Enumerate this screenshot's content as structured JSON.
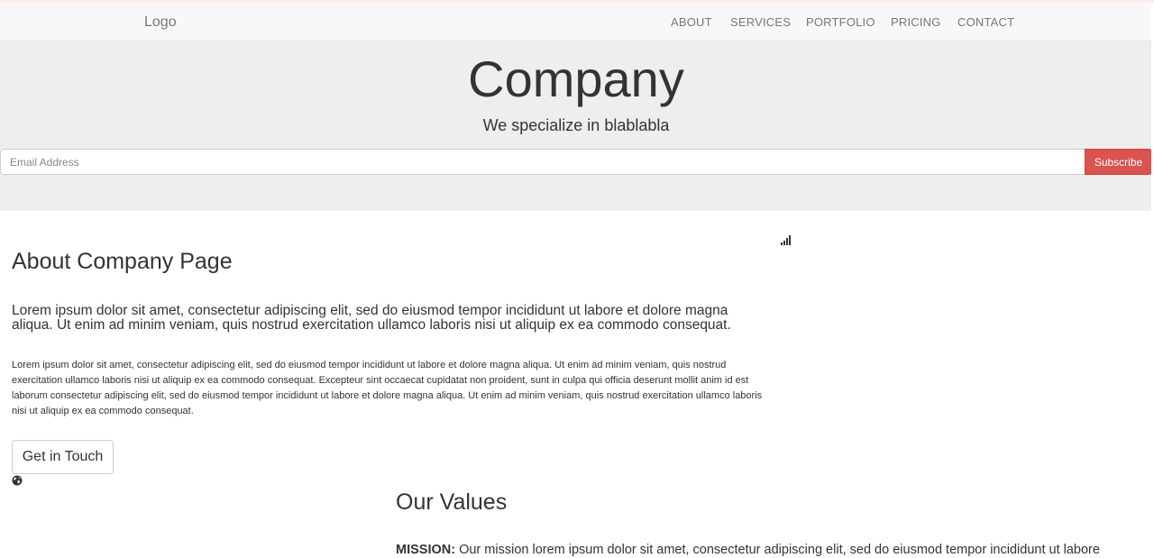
{
  "navbar": {
    "logo": "Logo",
    "items": [
      {
        "label": "ABOUT"
      },
      {
        "label": "SERVICES"
      },
      {
        "label": "PORTFOLIO"
      },
      {
        "label": "PRICING"
      },
      {
        "label": "CONTACT"
      }
    ]
  },
  "hero": {
    "title": "Company",
    "tagline": "We specialize in blablabla",
    "email_placeholder": "Email Address",
    "email_value": "",
    "subscribe_label": "Subscribe"
  },
  "about": {
    "title": "About Company Page",
    "lead": "Lorem ipsum dolor sit amet, consectetur adipiscing elit, sed do eiusmod tempor incididunt ut labore et dolore magna aliqua. Ut enim ad minim veniam, quis nostrud exercitation ullamco laboris nisi ut aliquip ex ea commodo consequat.",
    "body": "Lorem ipsum dolor sit amet, consectetur adipiscing elit, sed do eiusmod tempor incididunt ut labore et dolore magna aliqua. Ut enim ad minim veniam, quis nostrud exercitation ullamco laboris nisi ut aliquip ex ea commodo consequat. Excepteur sint occaecat cupidatat non proident, sunt in culpa qui officia deserunt mollit anim id est laborum consectetur adipiscing elit, sed do eiusmod tempor incididunt ut labore et dolore magna aliqua. Ut enim ad minim veniam, quis nostrud exercitation ullamco laboris nisi ut aliquip ex ea commodo consequat.",
    "button_label": "Get in Touch"
  },
  "values": {
    "title": "Our Values",
    "mission_label": "MISSION:",
    "mission_text": "Our mission lorem ipsum dolor sit amet, consectetur adipiscing elit, sed do eiusmod tempor incididunt ut labore"
  },
  "icons": {
    "signal": "signal-icon",
    "globe": "globe-icon"
  },
  "colors": {
    "subscribe": "#d9534f",
    "hero_background": "#eeeeee",
    "navbar_background": "#f8f8f8"
  }
}
